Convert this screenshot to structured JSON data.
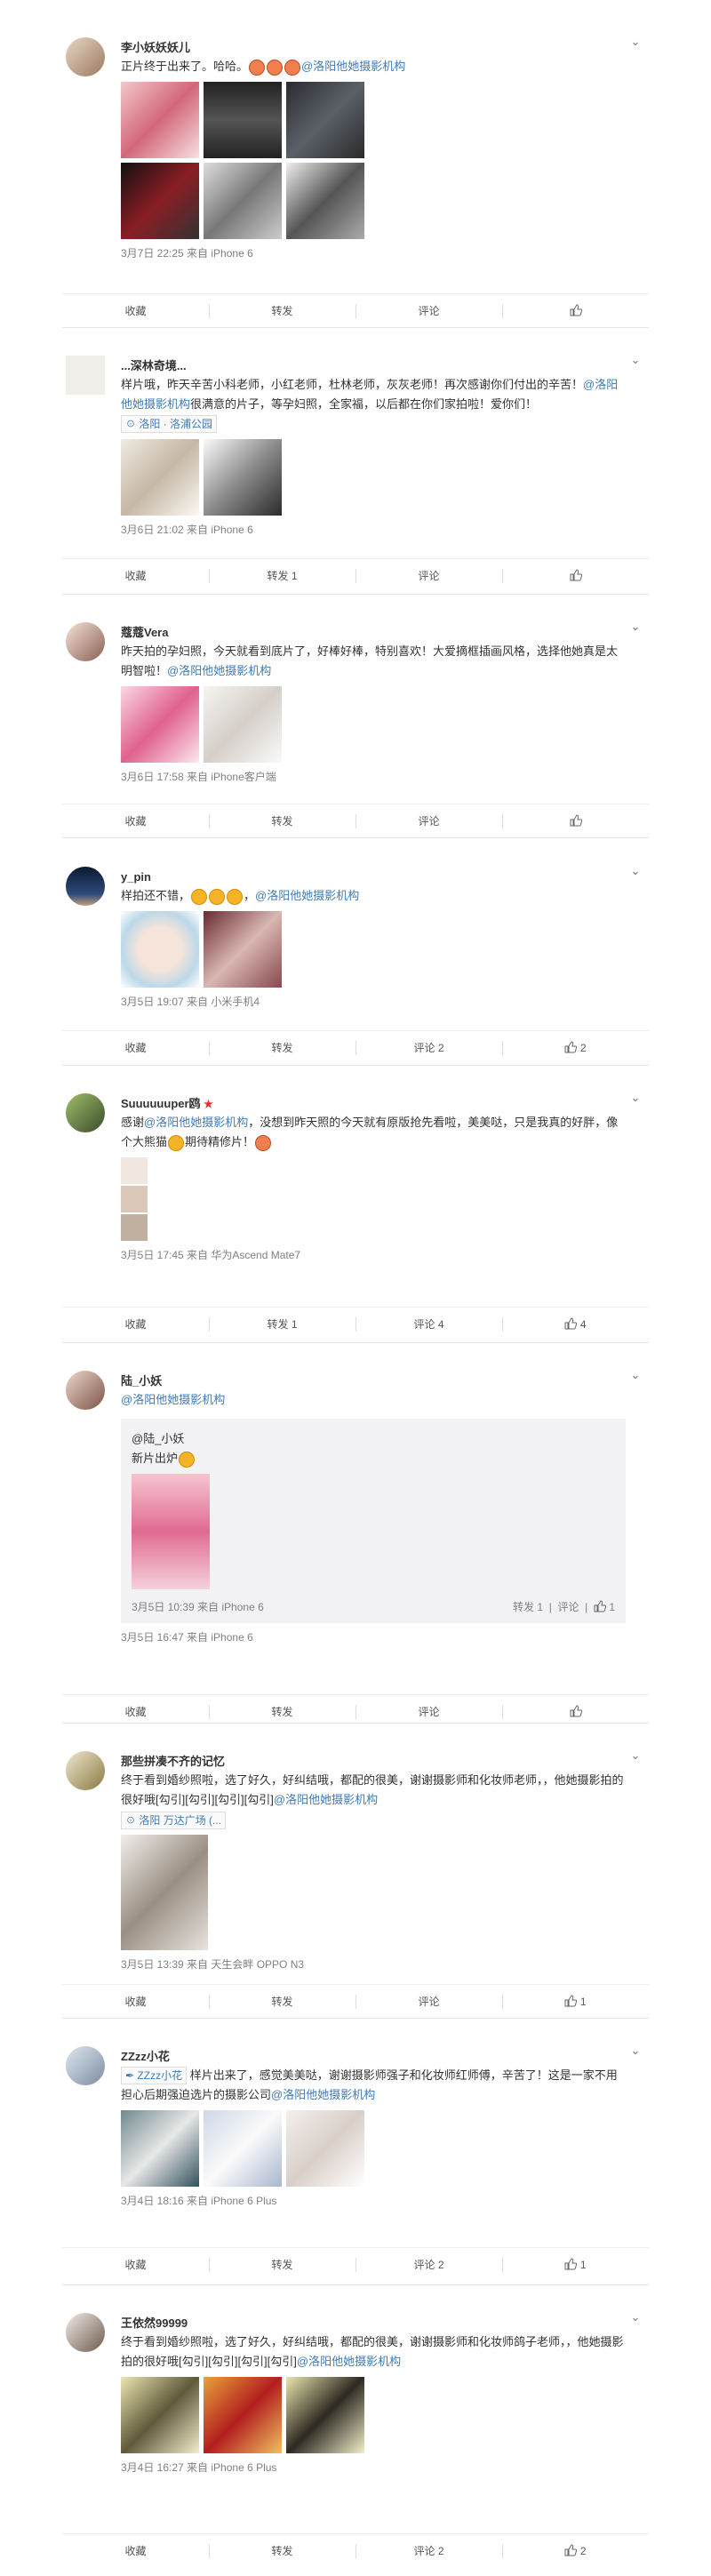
{
  "posts": [
    {
      "username": "李小妖妖妖儿",
      "text": "正片终于出来了。哈哈。",
      "mention": "@洛阳他她摄影机构",
      "meta": "3月7日 22:25 来自 iPhone 6",
      "actions": {
        "favorite": "收藏",
        "forward": "转发",
        "comment": "评论"
      }
    },
    {
      "username": "...深林奇境...",
      "text_a": "样片哦，昨天辛苦小科老师，小红老师，杜林老师，灰灰老师！再次感谢你们付出的辛苦！",
      "mention": "@洛阳他她摄影机构",
      "text_b": "很满意的片子，等孕妇照，全家福，以后都在你们家拍啦！爱你们！",
      "location": "洛阳 · 洛浦公园",
      "meta": "3月6日 21:02 来自 iPhone 6",
      "actions": {
        "favorite": "收藏",
        "forward": "转发 1",
        "comment": "评论"
      }
    },
    {
      "username": "蔻蔻Vera",
      "text": "昨天拍的孕妇照，今天就看到底片了，好棒好棒，特别喜欢！大爱摘框插画风格，选择他她真是太明智啦！",
      "mention": "@洛阳他她摄影机构",
      "meta": "3月6日 17:58 来自 iPhone客户端",
      "actions": {
        "favorite": "收藏",
        "forward": "转发",
        "comment": "评论"
      }
    },
    {
      "username": "y_pin",
      "text": "样拍还不错，",
      "mention": "@洛阳他她摄影机构",
      "meta": "3月5日 19:07 来自 小米手机4",
      "actions": {
        "favorite": "收藏",
        "forward": "转发",
        "comment": "评论 2",
        "like": "2"
      }
    },
    {
      "username": "Suuuuuuper鸥",
      "text_a": "感谢",
      "mention": "@洛阳他她摄影机构",
      "text_b": "，没想到昨天照的今天就有原版抢先看啦，美美哒，只是我真的好胖，像个大熊猫",
      "text_c": "期待精修片！",
      "meta": "3月5日 17:45 来自 华为Ascend Mate7",
      "actions": {
        "favorite": "收藏",
        "forward": "转发 1",
        "comment": "评论 4",
        "like": "4"
      }
    },
    {
      "username": "陆_小妖",
      "mention": "@洛阳他她摄影机构",
      "repost_user": "@陆_小妖",
      "repost_text": "新片出炉",
      "repost_meta": "3月5日 10:39 来自 iPhone 6",
      "repost_actions": {
        "forward": "转发 1",
        "comment": "评论",
        "like": "1"
      },
      "meta": "3月5日 16:47 来自 iPhone 6",
      "actions": {
        "favorite": "收藏",
        "forward": "转发",
        "comment": "评论"
      }
    },
    {
      "username": "那些拼凑不齐的记忆",
      "text_a": "终于看到婚纱照啦，选了好久，好纠结哦，都配的很美，谢谢摄影师和化妆师老师，，他她摄影拍的很好哦[勾引][勾引][勾引][勾引]",
      "mention": "@洛阳他她摄影机构",
      "location": "洛阳 万达广场 (...",
      "meta": "3月5日 13:39 来自 天生会畔 OPPO N3",
      "actions": {
        "favorite": "收藏",
        "forward": "转发",
        "comment": "评论",
        "like": "1"
      }
    },
    {
      "username": "ZZzz小花",
      "tag": "ZZzz小花",
      "text_a": "样片出来了，感觉美美哒，谢谢摄影师强子和化妆师红师傅，辛苦了！这是一家不用担心后期强迫选片的摄影公司",
      "mention": "@洛阳他她摄影机构",
      "meta": "3月4日 18:16 来自 iPhone 6 Plus",
      "actions": {
        "favorite": "收藏",
        "forward": "转发",
        "comment": "评论 2",
        "like": "1"
      }
    },
    {
      "username": "王依然99999",
      "text_a": "终于看到婚纱照啦，选了好久，好纠结哦，都配的很美，谢谢摄影师和化妆师鸽子老师，，他她摄影拍的很好哦[勾引][勾引][勾引][勾引]",
      "mention": "@洛阳他她摄影机构",
      "meta": "3月4日 16:27 来自 iPhone 6 Plus",
      "actions": {
        "favorite": "收藏",
        "forward": "转发",
        "comment": "评论 2",
        "like": "2"
      }
    }
  ],
  "icons": {
    "chevron": "chevron-down-icon",
    "like": "thumbs-up-icon",
    "location": "location-pin-icon"
  }
}
